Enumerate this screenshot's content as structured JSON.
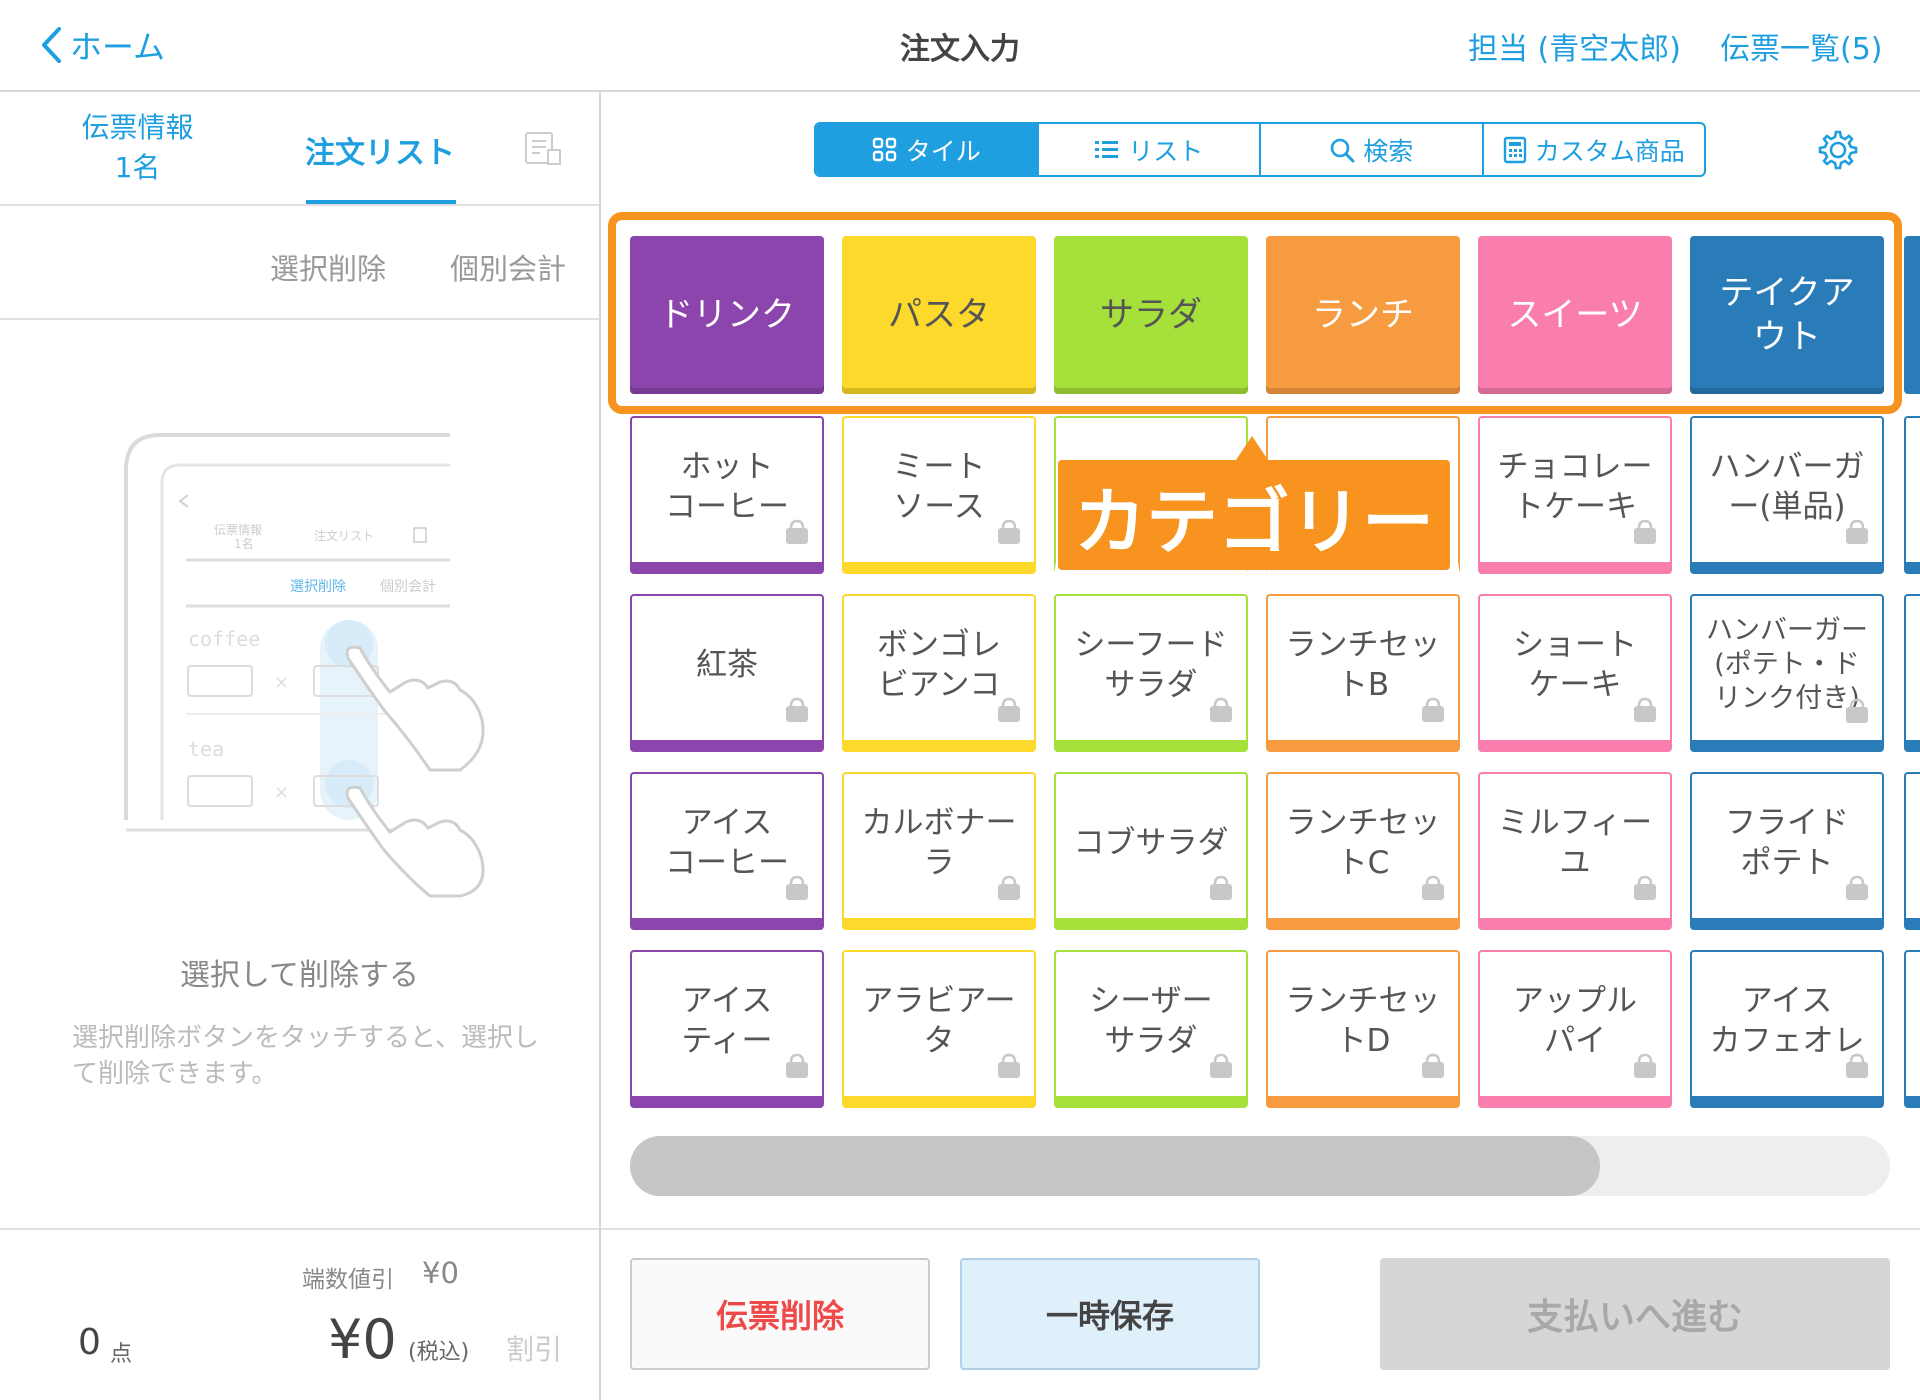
{
  "header": {
    "back_label": "ホーム",
    "title": "注文入力",
    "staff": "担当 (青空太郎)",
    "slips": "伝票一覧(5)"
  },
  "left": {
    "tab_info_line1": "伝票情報",
    "tab_info_line2": "1名",
    "tab_order": "注文リスト",
    "select_delete": "選択削除",
    "individual_pay": "個別会計",
    "empty_title": "選択して削除する",
    "empty_desc": "選択削除ボタンをタッチすると、選択して削除できます。",
    "illustration": {
      "tab1": "伝票情報",
      "tab1_sub": "1名",
      "tab2": "注文リスト",
      "btn1": "選択削除",
      "btn2": "個別会計",
      "item1": "coffee",
      "item2": "tea",
      "times": "×"
    }
  },
  "footer": {
    "rounding_label": "端数値引",
    "rounding_value": "¥0",
    "count": "0",
    "count_unit": "点",
    "total": "¥0",
    "tax_label": "(税込)",
    "discount": "割引"
  },
  "segments": [
    "タイル",
    "リスト",
    "検索",
    "カスタム商品"
  ],
  "categories": [
    {
      "label": "ドリンク",
      "color": "#8b45ad"
    },
    {
      "label": "パスタ",
      "color": "#fcd92a"
    },
    {
      "label": "サラダ",
      "color": "#a6e03a"
    },
    {
      "label": "ランチ",
      "color": "#f79b40"
    },
    {
      "label": "スイーツ",
      "color": "#f97eae"
    },
    {
      "label": "テイクア\nウト",
      "color": "#2a7cb8"
    }
  ],
  "callout": "カテゴリー",
  "products": [
    [
      "ホット\nコーヒー",
      "ミート\nソース",
      "",
      "",
      "チョコレー\nトケーキ",
      "ハンバーガ\nー(単品)"
    ],
    [
      "紅茶",
      "ボンゴレ\nビアンコ",
      "シーフード\nサラダ",
      "ランチセッ\nトB",
      "ショート\nケーキ",
      "ハンバーガー\n(ポテト・ド\nリンク付き)"
    ],
    [
      "アイス\nコーヒー",
      "カルボナー\nラ",
      "コブサラダ",
      "ランチセッ\nトC",
      "ミルフィー\nユ",
      "フライド\nポテト"
    ],
    [
      "アイス\nティー",
      "アラビアー\nタ",
      "シーザー\nサラダ",
      "ランチセッ\nトD",
      "アップル\nパイ",
      "アイス\nカフェオレ"
    ]
  ],
  "scroll_position": 0.77,
  "buttons": {
    "delete_slip": "伝票削除",
    "hold": "一時保存",
    "pay": "支払いへ進む"
  },
  "colors": {
    "accent": "#1f9fe0",
    "highlight": "#f7931e",
    "danger": "#ef4a4a"
  }
}
